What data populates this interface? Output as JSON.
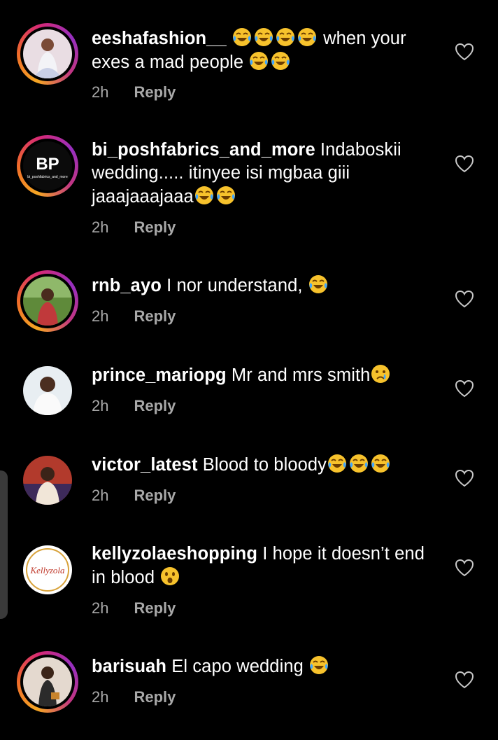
{
  "comments": [
    {
      "username": "eeshafashion__",
      "text_pre": " ",
      "emojis_mid": [
        "laugh-cry",
        "laugh-cry",
        "laugh-cry",
        "laugh-cry"
      ],
      "text_post": " when your exes a mad people ",
      "emojis_end": [
        "laugh-cry",
        "laugh-cry"
      ],
      "time": "2h",
      "reply": "Reply"
    },
    {
      "username": "bi_poshfabrics_and_more",
      "text": " Indaboskii wedding..... itinyee isi mgbaa giii jaaajaaajaaa",
      "emojis_end": [
        "laugh-cry",
        "laugh-cry"
      ],
      "avatar_logo": "BP",
      "avatar_caption": "bi_poshfabrics_and_more",
      "time": "2h",
      "reply": "Reply"
    },
    {
      "username": "rnb_ayo",
      "text": " I nor understand, ",
      "emojis_end": [
        "laugh-cry"
      ],
      "time": "2h",
      "reply": "Reply"
    },
    {
      "username": "prince_mariopg",
      "text": " Mr and mrs smith",
      "emojis_end": [
        "crying-face"
      ],
      "time": "2h",
      "reply": "Reply"
    },
    {
      "username": "victor_latest",
      "text": " Blood to bloody",
      "emojis_end": [
        "laugh-cry",
        "laugh-cry",
        "laugh-cry"
      ],
      "time": "2h",
      "reply": "Reply"
    },
    {
      "username": "kellyzolaeshopping",
      "text": " I hope it doesn’t end in blood ",
      "emojis_end": [
        "astonished-face"
      ],
      "avatar_logo": "Kellyzola",
      "time": "2h",
      "reply": "Reply"
    },
    {
      "username": "barisuah",
      "text": " El capo wedding ",
      "emojis_end": [
        "laugh-cry"
      ],
      "time": "2h",
      "reply": "Reply"
    }
  ],
  "colors": {
    "background": "#000000",
    "text": "#ffffff",
    "meta": "#a8a8a8",
    "emoji": "#f7c22c"
  }
}
